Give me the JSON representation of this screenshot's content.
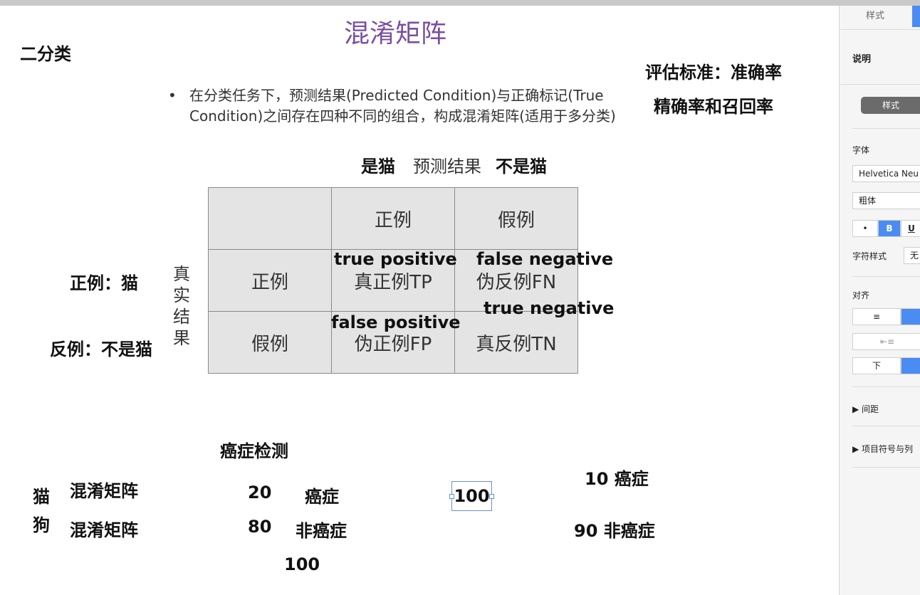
{
  "slide": {
    "title": "混淆矩阵",
    "left_heading": "二分类",
    "right_top_1": "评估标准：准确率",
    "right_top_2": "精确率和召回率",
    "bullet_dot": "•",
    "bullet_text": "在分类任务下，预测结果(Predicted Condition)与正确标记(True Condition)之间存在四种不同的组合，构成混淆矩阵(适用于多分类)",
    "pred_header_yes": "是猫",
    "pred_header_label": "预测结果",
    "pred_header_no": "不是猫",
    "matrix": {
      "col_headers": [
        "",
        "正例",
        "假例"
      ],
      "rows": [
        [
          "正例",
          "真正例TP",
          "伪反例FN"
        ],
        [
          "假例",
          "伪正例FP",
          "真反例TN"
        ]
      ]
    },
    "overlays": {
      "tp": "true  positive",
      "fn": "false  negative",
      "tn": "true negative",
      "fp": "false  positive"
    },
    "truth_chars": [
      "真",
      "实",
      "结",
      "果"
    ],
    "pos_label": "正例：猫",
    "neg_label": "反例：不是猫",
    "cancer": {
      "heading": "癌症检测",
      "cat": "猫",
      "dog": "狗",
      "cm1": "混淆矩阵",
      "cm2": "混淆矩阵",
      "n20": "20",
      "cancer": "癌症",
      "n80": "80",
      "non_cancer": "非癌症",
      "total_left": "100",
      "selected_box": "100",
      "right_1": "10 癌症",
      "right_2": "90 非癌症"
    }
  },
  "inspector": {
    "tab_style": "样式",
    "section_title": "说明",
    "style_pill": "样式",
    "font_label": "字体",
    "font_name": "Helvetica Neu",
    "font_weight": "粗体",
    "seg_dot": "•",
    "seg_bold": "B",
    "seg_underline": "U",
    "char_style_label": "字符样式",
    "char_style_value": "无",
    "align_label": "对齐",
    "align_left_icon": "≡",
    "indent_icon": "⇤≡",
    "valign_bottom": "下",
    "spacing": "▶  间距",
    "bullets": "▶  项目符号与列"
  },
  "colors": {
    "title": "#7a4fa0",
    "accent": "#4a8cf1",
    "cell": "#e4e4e4"
  }
}
